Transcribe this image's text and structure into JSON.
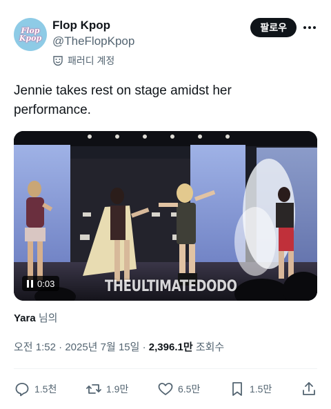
{
  "author": {
    "display_name": "Flop Kpop",
    "handle": "@TheFlopKpop",
    "avatar_line1": "Flop",
    "avatar_line2": "Kpop",
    "badge_label": "패러디 계정"
  },
  "follow_label": "팔로우",
  "tweet": {
    "text": "Jennie takes rest on stage amidst her performance."
  },
  "media": {
    "kind": "video",
    "duration": "0:03",
    "watermark": "THEULTIMATEDODO"
  },
  "credit": {
    "name": "Yara",
    "suffix": "님의"
  },
  "meta": {
    "time": "오전 1:52",
    "date": "2025년 7월 15일",
    "views_value": "2,396.1만",
    "views_label": "조회수"
  },
  "actions": {
    "replies": "1.5천",
    "reposts": "1.9만",
    "likes": "6.5만",
    "bookmarks": "1.5만"
  },
  "colors": {
    "text_primary": "#0f1419",
    "text_secondary": "#536471",
    "follow_button": "#0f1419",
    "avatar_bg": "#8ecbe6",
    "divider": "#eff3f4"
  }
}
